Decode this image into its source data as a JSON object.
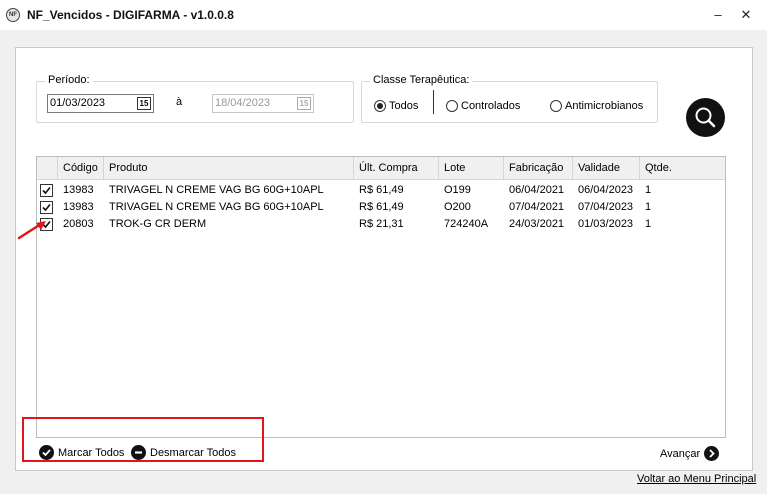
{
  "window": {
    "title": "NF_Vencidos - DIGIFARMA - v1.0.0.8",
    "app_icon_text": "NF",
    "minimize_glyph": "–",
    "close_glyph": "✕"
  },
  "periodo": {
    "label": "Período:",
    "start_date": "01/03/2023",
    "separator": "à",
    "end_date": "18/04/2023",
    "calendar_glyph": "15"
  },
  "classe": {
    "label": "Classe Terapêutica:",
    "options": [
      {
        "label": "Todos",
        "selected": true
      },
      {
        "label": "Controlados",
        "selected": false
      },
      {
        "label": "Antimicrobianos",
        "selected": false
      }
    ]
  },
  "grid": {
    "columns": [
      "Código",
      "Produto",
      "Últ. Compra",
      "Lote",
      "Fabricação",
      "Validade",
      "Qtde."
    ],
    "rows": [
      {
        "checked": true,
        "codigo": "13983",
        "produto": "TRIVAGEL N CREME VAG BG 60G+10APL",
        "ult_compra": "R$ 61,49",
        "lote": "O199",
        "fabricacao": "06/04/2021",
        "validade": "06/04/2023",
        "qtde": "1"
      },
      {
        "checked": true,
        "codigo": "13983",
        "produto": "TRIVAGEL N CREME VAG BG 60G+10APL",
        "ult_compra": "R$ 61,49",
        "lote": "O200",
        "fabricacao": "07/04/2021",
        "validade": "07/04/2023",
        "qtde": "1"
      },
      {
        "checked": true,
        "codigo": "20803",
        "produto": "TROK-G CR DERM",
        "ult_compra": "R$ 21,31",
        "lote": "724240A",
        "fabricacao": "24/03/2021",
        "validade": "01/03/2023",
        "qtde": "1"
      }
    ]
  },
  "actions": {
    "mark_all": "Marcar Todos",
    "unmark_all": "Desmarcar Todos",
    "advance": "Avançar",
    "back_menu": "Voltar ao Menu Principal"
  },
  "annotations": {
    "highlight_color": "#e3151a",
    "arrow_color": "#e3151a"
  }
}
